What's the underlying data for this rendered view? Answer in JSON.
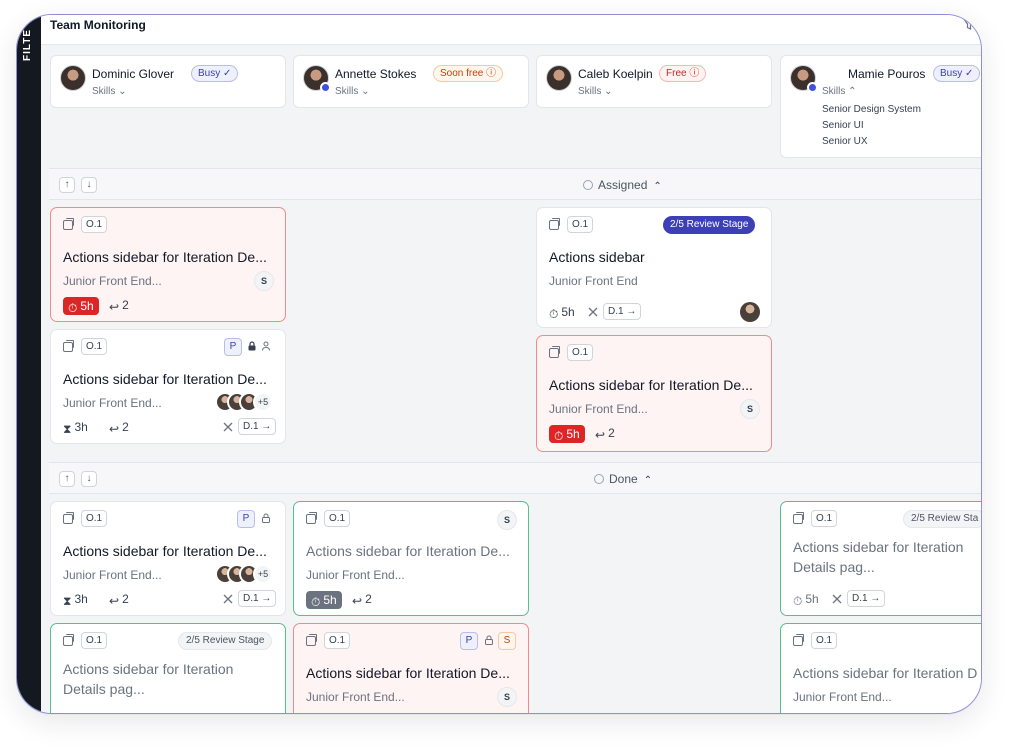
{
  "app": {
    "title": "Team Monitoring",
    "filter_label": "FILTE"
  },
  "members": [
    {
      "name": "Dominic Glover",
      "status": "Busy ✓",
      "skills_label": "Skills ⌄"
    },
    {
      "name": "Annette Stokes",
      "status": "Soon free ⓘ",
      "skills_label": "Skills ⌄"
    },
    {
      "name": "Caleb Koelpin",
      "status": "Free ⓘ",
      "skills_label": "Skills ⌄"
    },
    {
      "name": "Mamie Pouros",
      "status": "Busy ✓",
      "skills_label": "Skills ⌃",
      "skills": [
        "Senior Design System",
        "Senior UI",
        "Senior UX"
      ]
    }
  ],
  "sections": {
    "assigned": {
      "title": "Assigned"
    },
    "done": {
      "title": "Done"
    }
  },
  "cards": {
    "a1": {
      "code": "O.1",
      "title": "Actions sidebar for Iteration De...",
      "subtitle": "Junior Front End...",
      "initial": "S",
      "time": "5h",
      "iterations": "2"
    },
    "a2": {
      "code": "O.1",
      "title": "Actions sidebar for Iteration De...",
      "subtitle": "Junior Front End...",
      "badge_p": "P",
      "more": "+5",
      "time": "3h",
      "iterations": "2",
      "d_badge": "D.1 →"
    },
    "a3": {
      "code": "O.1",
      "stage": "2/5 Review Stage",
      "title": "Actions sidebar",
      "subtitle": "Junior Front End",
      "time": "5h",
      "d_badge": "D.1 →"
    },
    "a4": {
      "code": "O.1",
      "title": "Actions sidebar for Iteration De...",
      "subtitle": "Junior Front End...",
      "initial": "S",
      "time": "5h",
      "iterations": "2"
    },
    "d1": {
      "code": "O.1",
      "badge_p": "P",
      "title": "Actions sidebar for Iteration De...",
      "subtitle": "Junior Front End...",
      "more": "+5",
      "time": "3h",
      "iterations": "2",
      "d_badge": "D.1 →"
    },
    "d2": {
      "code": "O.1",
      "initial": "S",
      "title": "Actions sidebar for Iteration De...",
      "subtitle": "Junior Front End...",
      "time": "5h",
      "iterations": "2"
    },
    "d3": {
      "code": "O.1",
      "stage": "2/5 Review Sta",
      "title": "Actions sidebar for Iteration Details pag...",
      "time": "5h",
      "d_badge": "D.1 →"
    },
    "d4": {
      "code": "O.1",
      "stage": "2/5 Review Stage",
      "title": "Actions sidebar for Iteration Details pag..."
    },
    "d5": {
      "code": "O.1",
      "badge_p": "P",
      "badge_s": "S",
      "title": "Actions sidebar for Iteration De...",
      "subtitle": "Junior Front End...",
      "initial": "S"
    },
    "d6": {
      "code": "O.1",
      "title": "Actions sidebar for Iteration D",
      "subtitle": "Junior Front End..."
    }
  }
}
